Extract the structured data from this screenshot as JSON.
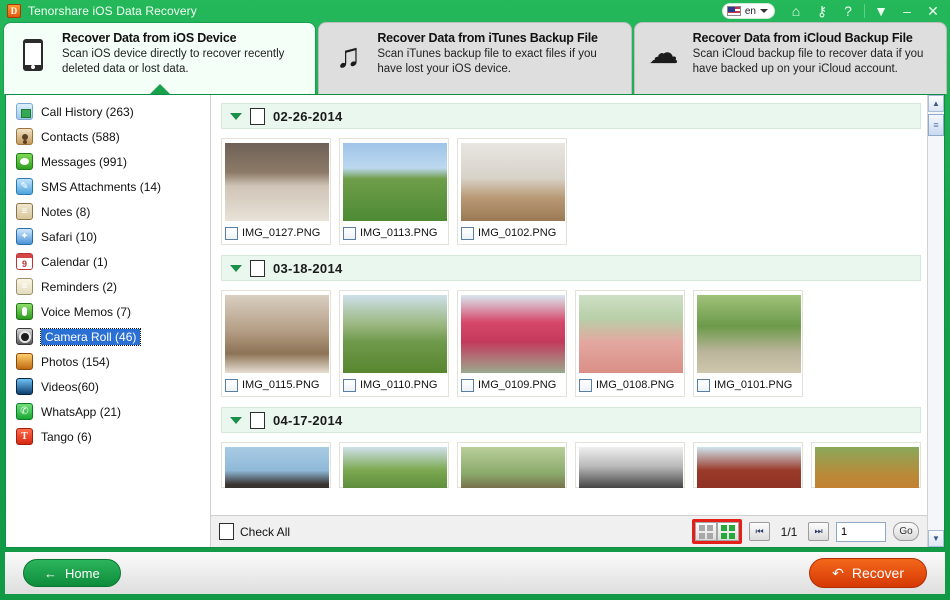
{
  "window": {
    "title": "Tenorshare iOS Data Recovery",
    "logo_glyph": "D",
    "language": "en",
    "icons": {
      "home": "⌂",
      "key": "⚷",
      "help": "?",
      "dropdown": "▼",
      "minimize": "–",
      "close": "✕"
    }
  },
  "tabs": [
    {
      "id": "ios-device",
      "icon": "phone-icon",
      "title": "Recover Data from iOS Device",
      "desc": "Scan iOS device directly to recover recently deleted data or lost data.",
      "active": true
    },
    {
      "id": "itunes-backup",
      "icon": "music-note-icon",
      "title": "Recover Data from iTunes Backup File",
      "desc": "Scan iTunes backup file to exact files if you have lost your iOS device.",
      "active": false
    },
    {
      "id": "icloud-backup",
      "icon": "cloud-icon",
      "title": "Recover Data from iCloud Backup File",
      "desc": "Scan iCloud backup file to recover data if you have backed up on your iCloud account.",
      "active": false
    }
  ],
  "sidebar": {
    "items": [
      {
        "label": "Call History (263)",
        "icon": "call-history-icon",
        "cls": "ic-call",
        "glyph": "",
        "selected": false
      },
      {
        "label": "Contacts (588)",
        "icon": "contacts-icon",
        "cls": "ic-contacts",
        "glyph": "",
        "selected": false
      },
      {
        "label": "Messages (991)",
        "icon": "messages-icon",
        "cls": "ic-msg",
        "glyph": "",
        "selected": false
      },
      {
        "label": "SMS Attachments (14)",
        "icon": "sms-attachments-icon",
        "cls": "ic-sms",
        "glyph": "✎",
        "selected": false
      },
      {
        "label": "Notes (8)",
        "icon": "notes-icon",
        "cls": "ic-notes",
        "glyph": "≡",
        "selected": false
      },
      {
        "label": "Safari (10)",
        "icon": "safari-icon",
        "cls": "ic-safari",
        "glyph": "✦",
        "selected": false
      },
      {
        "label": "Calendar (1)",
        "icon": "calendar-icon",
        "cls": "ic-cal",
        "glyph": "9",
        "selected": false
      },
      {
        "label": "Reminders (2)",
        "icon": "reminders-icon",
        "cls": "ic-rem",
        "glyph": "≡",
        "selected": false
      },
      {
        "label": "Voice Memos (7)",
        "icon": "voice-memos-icon",
        "cls": "ic-voice",
        "glyph": "",
        "selected": false
      },
      {
        "label": "Camera Roll (46)",
        "icon": "camera-roll-icon",
        "cls": "ic-camera",
        "glyph": "",
        "selected": true
      },
      {
        "label": "Photos (154)",
        "icon": "photos-icon",
        "cls": "ic-photos",
        "glyph": "",
        "selected": false
      },
      {
        "label": "Videos(60)",
        "icon": "videos-icon",
        "cls": "ic-videos",
        "glyph": "",
        "selected": false
      },
      {
        "label": "WhatsApp (21)",
        "icon": "whatsapp-icon",
        "cls": "ic-whatsapp",
        "glyph": "✆",
        "selected": false
      },
      {
        "label": "Tango (6)",
        "icon": "tango-icon",
        "cls": "ic-tango",
        "glyph": "T",
        "selected": false
      }
    ]
  },
  "groups": [
    {
      "date": "02-26-2014",
      "thumbs": [
        {
          "name": "IMG_0127.PNG",
          "scene": "family-dinner"
        },
        {
          "name": "IMG_0113.PNG",
          "scene": "kids-bubbles"
        },
        {
          "name": "IMG_0102.PNG",
          "scene": "playroom"
        }
      ]
    },
    {
      "date": "03-18-2014",
      "thumbs": [
        {
          "name": "IMG_0115.PNG",
          "scene": "reading-lesson"
        },
        {
          "name": "IMG_0110.PNG",
          "scene": "park-stroller"
        },
        {
          "name": "IMG_0109.PNG",
          "scene": "carnival-dancers"
        },
        {
          "name": "IMG_0108.PNG",
          "scene": "two-girls"
        },
        {
          "name": "IMG_0101.PNG",
          "scene": "garden-house"
        }
      ]
    },
    {
      "date": "04-17-2014",
      "thumbs": [
        {
          "name": "",
          "scene": "horses"
        },
        {
          "name": "",
          "scene": "green-tree"
        },
        {
          "name": "",
          "scene": "tree-trunk"
        },
        {
          "name": "",
          "scene": "bw-photo"
        },
        {
          "name": "",
          "scene": "red-barn"
        },
        {
          "name": "",
          "scene": "autumn"
        }
      ]
    }
  ],
  "content_bar": {
    "check_all_label": "Check All",
    "view_list_label": "list-view",
    "view_grid_label": "grid-view",
    "prev_glyph": "⏮",
    "next_glyph": "⏭",
    "page_info": "1/1",
    "page_input_value": "1",
    "go_label": "Go",
    "highlight_color": "#e32119"
  },
  "scrollbar": {
    "up_glyph": "▲",
    "down_glyph": "▼",
    "thumb_glyph": "≡"
  },
  "footer": {
    "home_label": "Home",
    "home_icon": "←",
    "recover_label": "Recover",
    "recover_icon": "↶"
  }
}
